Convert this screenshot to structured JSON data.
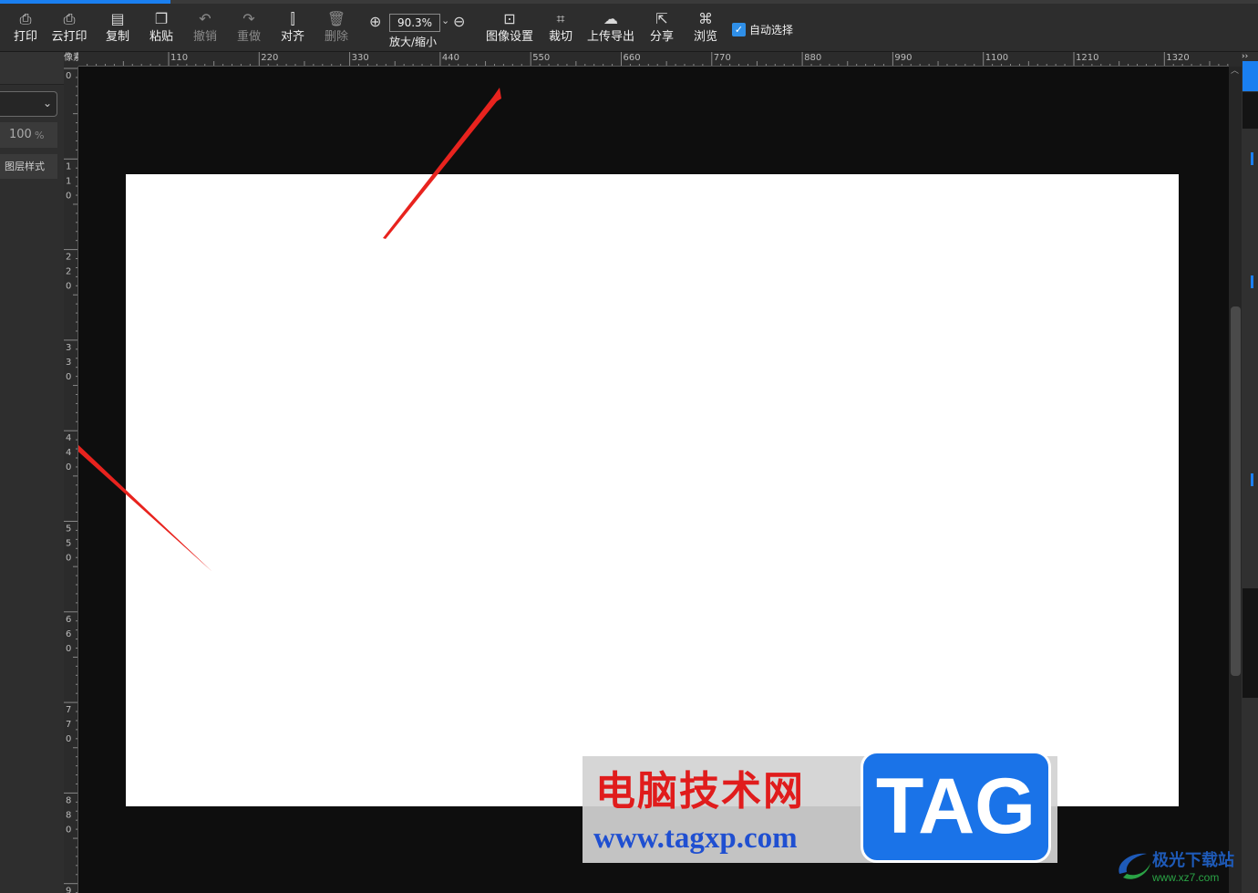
{
  "toolbar": {
    "print": "打印",
    "cloud_print": "云打印",
    "copy": "复制",
    "paste": "粘贴",
    "undo": "撤销",
    "redo": "重做",
    "align": "对齐",
    "delete": "删除",
    "zoom_value": "90.3%",
    "zoom_label": "放大/缩小",
    "image_settings": "图像设置",
    "crop": "裁切",
    "upload_export": "上传导出",
    "share": "分享",
    "browse": "浏览",
    "auto_select": "自动选择"
  },
  "left_panel": {
    "opacity_value": "100",
    "opacity_unit": "%",
    "layer_style": "图层样式"
  },
  "ruler": {
    "unit": "像素",
    "top_labels": [
      "110",
      "220",
      "330",
      "440",
      "550",
      "660",
      "770",
      "880",
      "990",
      "1100",
      "1210",
      "1320"
    ],
    "left_labels": [
      "0",
      "1\n1\n0",
      "2\n2\n0",
      "3\n3\n0",
      "4\n4\n0",
      "5\n5\n0",
      "6\n6\n0",
      "7\n7\n0",
      "8\n8\n0",
      "9"
    ]
  },
  "watermark": {
    "chinese": "电脑技术网",
    "tag": "TAG",
    "url": "www.tagxp.com"
  },
  "corner_logo": {
    "name": "极光下载站",
    "url": "www.xz7.com"
  },
  "colors": {
    "accent": "#1a7ff0",
    "arrow": "#e8231e",
    "canvas_bg": "#0e0e0e",
    "document": "#ffffff"
  }
}
